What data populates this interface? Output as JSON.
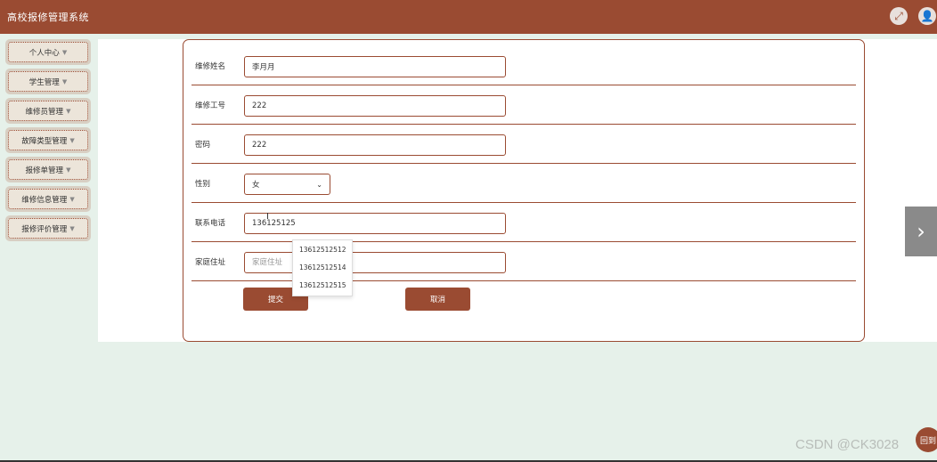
{
  "app": {
    "title": "高校报修管理系统"
  },
  "header": {
    "fullscreen_icon": "fullscreen-icon",
    "user_icon": "user-icon"
  },
  "sidebar": {
    "items": [
      {
        "label": "个人中心"
      },
      {
        "label": "学生管理"
      },
      {
        "label": "维修员管理"
      },
      {
        "label": "故障类型管理"
      },
      {
        "label": "报修单管理"
      },
      {
        "label": "维修信息管理"
      },
      {
        "label": "报修评价管理"
      }
    ]
  },
  "form": {
    "name": {
      "label": "维修姓名",
      "value": "李月月"
    },
    "worker_id": {
      "label": "维修工号",
      "value": "222"
    },
    "password": {
      "label": "密码",
      "value": "222"
    },
    "gender": {
      "label": "性别",
      "value": "女"
    },
    "phone": {
      "label": "联系电话",
      "value": "136125125"
    },
    "address": {
      "label": "家庭住址",
      "value": "",
      "placeholder": "家庭住址"
    },
    "submit_label": "提交",
    "cancel_label": "取消"
  },
  "autocomplete": {
    "options": [
      "13612512512",
      "13612512514",
      "13612512515"
    ]
  },
  "watermark": "CSDN @CK3028",
  "float_button": "回到"
}
